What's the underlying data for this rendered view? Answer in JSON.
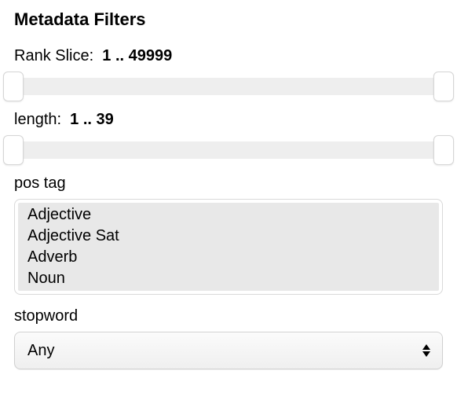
{
  "title": "Metadata Filters",
  "rank_slice": {
    "label": "Rank Slice",
    "range_text": "1 .. 49999",
    "min": 1,
    "max": 49999
  },
  "length": {
    "label": "length",
    "range_text": "1 .. 39",
    "min": 1,
    "max": 39
  },
  "pos_tag": {
    "label": "pos tag",
    "options": [
      "Adjective",
      "Adjective Sat",
      "Adverb",
      "Noun"
    ]
  },
  "stopword": {
    "label": "stopword",
    "selected": "Any"
  }
}
